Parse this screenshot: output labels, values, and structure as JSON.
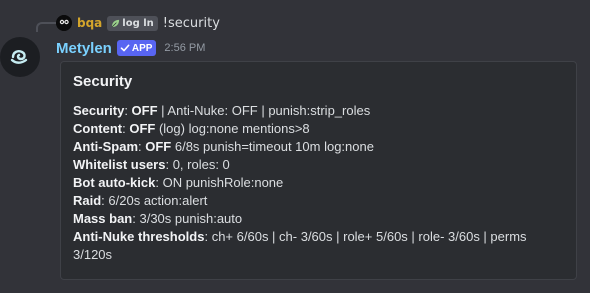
{
  "reply": {
    "username": "bqa",
    "tag_label": "log ln",
    "message": "!security"
  },
  "author": {
    "name": "Metylen",
    "badge": "APP",
    "timestamp": "2:56 PM"
  },
  "embed": {
    "title": "Security",
    "lines": [
      {
        "label": "Security",
        "sep": ": ",
        "bold_value": "OFF",
        "rest": " | Anti-Nuke: OFF | punish:strip_roles"
      },
      {
        "label": "Content",
        "sep": ": ",
        "bold_value": "OFF",
        "rest": " (log) log:none mentions>8"
      },
      {
        "label": "Anti-Spam",
        "sep": ": ",
        "bold_value": "OFF",
        "rest": " 6/8s punish=timeout 10m log:none"
      },
      {
        "label": "Whitelist users",
        "sep": ": ",
        "bold_value": "",
        "rest": "0, roles: 0"
      },
      {
        "label": "Bot auto-kick",
        "sep": ": ",
        "bold_value": "",
        "rest": "ON punishRole:none"
      },
      {
        "label": "Raid",
        "sep": ": ",
        "bold_value": "",
        "rest": "6/20s action:alert"
      },
      {
        "label": "Mass ban",
        "sep": ": ",
        "bold_value": "",
        "rest": "3/30s punish:auto"
      },
      {
        "label": "Anti-Nuke thresholds",
        "sep": ": ",
        "bold_value": "",
        "rest": "ch+ 6/60s | ch- 3/60s | role+ 5/60s | role- 3/60s | perms 3/120s"
      }
    ]
  },
  "colors": {
    "background": "#323339",
    "embed_bg": "#2b2d31",
    "username": "#7ad1ff",
    "reply_username": "#d4a52b",
    "app_badge": "#5865f2"
  },
  "icons": {
    "reply_avatar": "dark-character-avatar-icon",
    "reply_tag": "leaf-icon",
    "author_avatar": "swirl-logo-icon",
    "badge_check": "checkmark-icon"
  }
}
